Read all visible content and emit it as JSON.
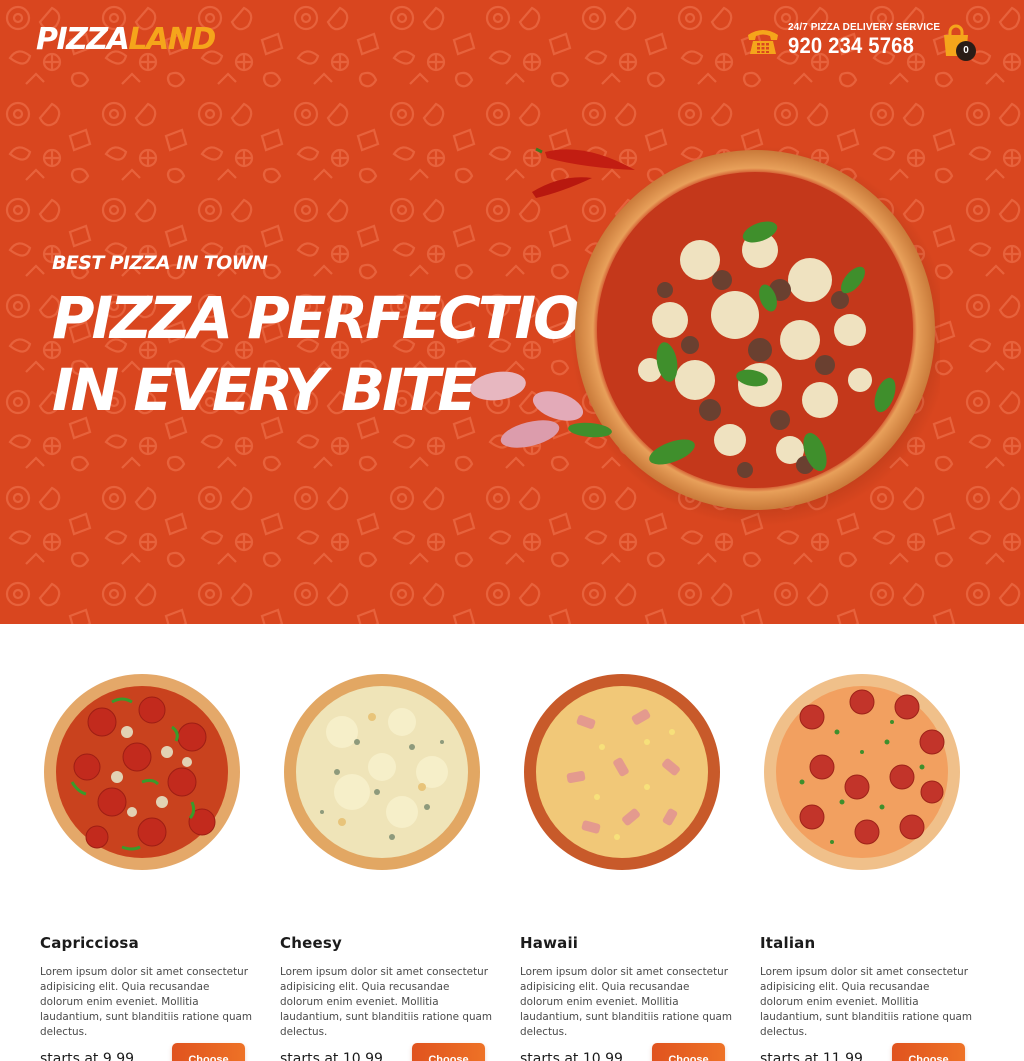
{
  "header": {
    "logo_part1": "PIZZA",
    "logo_part2": "LAND",
    "service_label": "24/7 PIZZA DELIVERY SERVICE",
    "phone": "920 234 5768",
    "phone_icon": "telephone-icon",
    "cart_icon": "shopping-bag-icon",
    "cart_count": "0"
  },
  "hero": {
    "tagline": "BEST PIZZA IN TOWN",
    "headline_line1": "PIZZA PERFECTION",
    "headline_line2": "IN EVERY BITE"
  },
  "menu": {
    "items": [
      {
        "name": "Capricciosa",
        "description": "Lorem ipsum dolor sit amet consectetur adipisicing elit. Quia recusandae dolorum enim eveniet. Mollitia laudantium, sunt blanditiis ratione quam delectus.",
        "price": "starts at 9.99",
        "button": "Choose"
      },
      {
        "name": "Cheesy",
        "description": "Lorem ipsum dolor sit amet consectetur adipisicing elit. Quia recusandae dolorum enim eveniet. Mollitia laudantium, sunt blanditiis ratione quam delectus.",
        "price": "starts at 10.99",
        "button": "Choose"
      },
      {
        "name": "Hawaii",
        "description": "Lorem ipsum dolor sit amet consectetur adipisicing elit. Quia recusandae dolorum enim eveniet. Mollitia laudantium, sunt blanditiis ratione quam delectus.",
        "price": "starts at 10.99",
        "button": "Choose"
      },
      {
        "name": "Italian",
        "description": "Lorem ipsum dolor sit amet consectetur adipisicing elit. Quia recusandae dolorum enim eveniet. Mollitia laudantium, sunt blanditiis ratione quam delectus.",
        "price": "starts at 11.99",
        "button": "Choose"
      }
    ]
  },
  "colors": {
    "hero_background": "#d9461f",
    "accent_yellow": "#f5a51b",
    "button_orange": "#e85f22",
    "text_dark": "#1b1b1b"
  }
}
